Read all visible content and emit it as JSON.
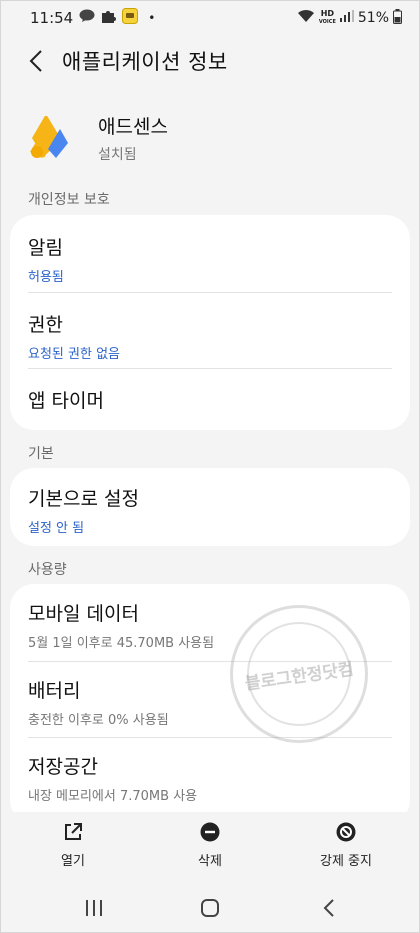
{
  "status_bar": {
    "time": "11:54",
    "dot": "•",
    "network": "HD",
    "network_sub": "VOICE",
    "battery": "51%"
  },
  "app_bar": {
    "title": "애플리케이션 정보"
  },
  "app": {
    "name": "애드센스",
    "status": "설치됨"
  },
  "sections": {
    "privacy": "개인정보 보호",
    "basic": "기본",
    "usage": "사용량"
  },
  "privacy_items": {
    "notifications": {
      "title": "알림",
      "sub": "허용됨"
    },
    "permissions": {
      "title": "권한",
      "sub": "요청된 권한 없음"
    },
    "app_timer": {
      "title": "앱 타이머"
    }
  },
  "basic_items": {
    "default": {
      "title": "기본으로 설정",
      "sub": "설정 안 됨"
    }
  },
  "usage_items": {
    "mobile_data": {
      "title": "모바일 데이터",
      "sub": "5월 1일 이후로 45.70MB 사용됨"
    },
    "battery": {
      "title": "배터리",
      "sub": "충전한 이후로 0% 사용됨"
    },
    "storage": {
      "title": "저장공간",
      "sub": "내장 메모리에서 7.70MB 사용"
    }
  },
  "actions": {
    "open": "열기",
    "delete": "삭제",
    "force_stop": "강제 중지"
  },
  "watermark": {
    "text": "블로그한정닷컴"
  },
  "colors": {
    "accent": "#2c64c9",
    "background": "#f4f4f4",
    "card": "#ffffff"
  }
}
